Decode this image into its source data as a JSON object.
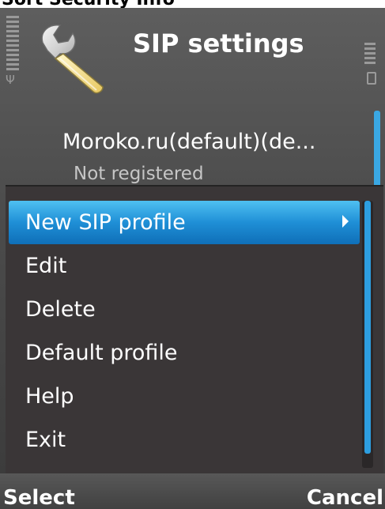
{
  "top_strip": {
    "text": "Sort Security Info"
  },
  "header": {
    "title": "SIP settings",
    "icon": "wrench-icon"
  },
  "status": {
    "signal_icon": "signal-strength-icon",
    "antenna_glyph": "Ψ",
    "battery_icon": "battery-icon"
  },
  "profile_list": {
    "items": [
      {
        "name": "Moroko.ru(default)(de...",
        "status": "Not registered"
      }
    ]
  },
  "options_menu": {
    "items": [
      {
        "label": "New SIP profile",
        "selected": true,
        "has_submenu": true
      },
      {
        "label": "Edit"
      },
      {
        "label": "Delete"
      },
      {
        "label": "Default profile"
      },
      {
        "label": "Help"
      },
      {
        "label": "Exit"
      }
    ]
  },
  "softkeys": {
    "left": "Select",
    "right": "Cancel"
  },
  "colors": {
    "accent": "#1f8fd6",
    "scrollbar": "#2d9ee0",
    "menu_background": "#3a3637"
  }
}
